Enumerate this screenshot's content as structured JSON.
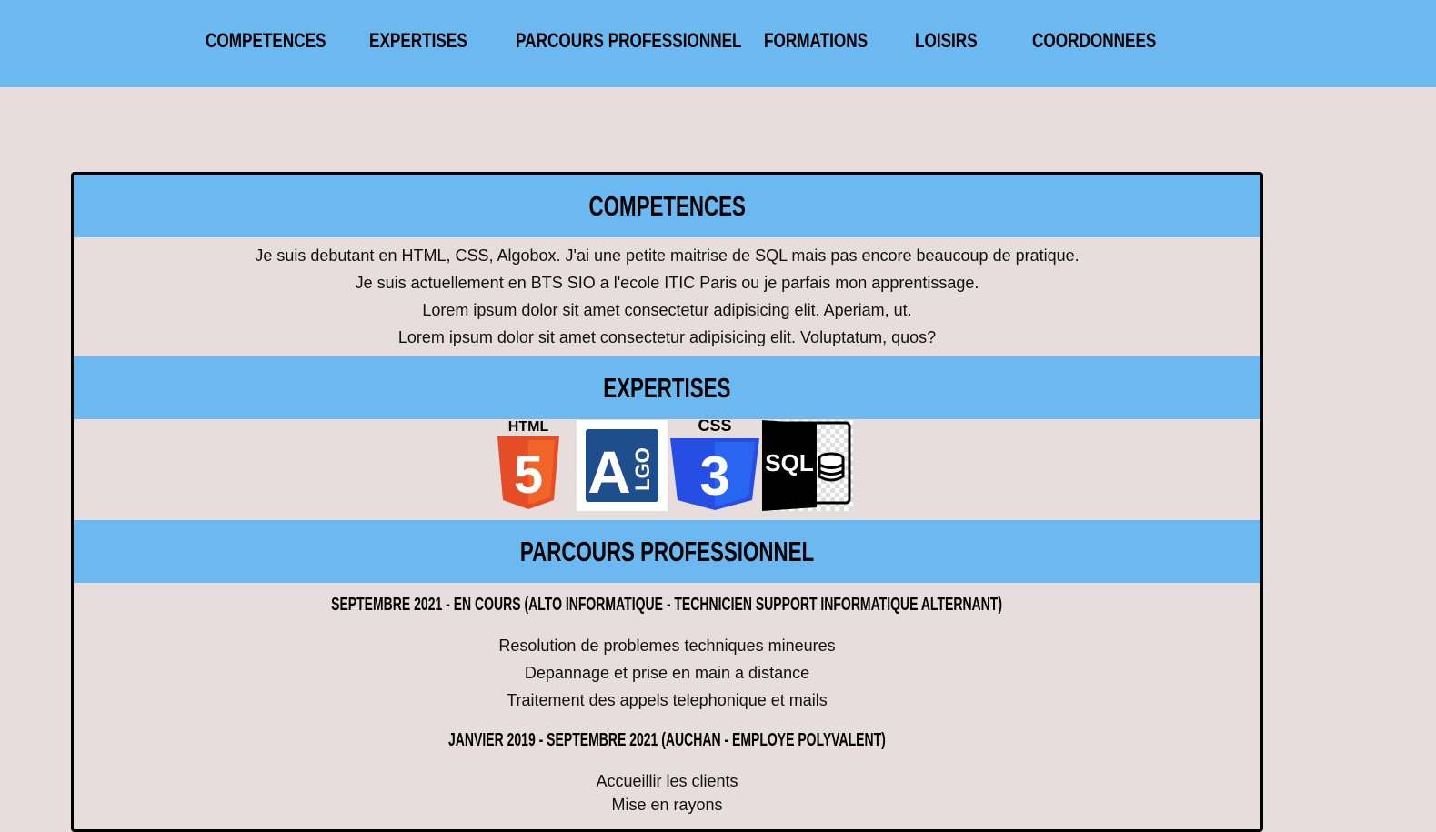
{
  "nav": {
    "items": [
      "COMPETENCES",
      "EXPERTISES",
      "PARCOURS PROFESSIONNEL",
      "FORMATIONS",
      "LOISIRS",
      "COORDONNEES"
    ]
  },
  "competences": {
    "title": "COMPETENCES",
    "lines": [
      "Je suis debutant en HTML, CSS, Algobox. J'ai une petite maitrise de SQL mais pas encore beaucoup de pratique.",
      "Je suis actuellement en BTS SIO a l'ecole ITIC Paris ou je parfais mon apprentissage.",
      "Lorem ipsum dolor sit amet consectetur adipisicing elit. Aperiam, ut.",
      "Lorem ipsum dolor sit amet consectetur adipisicing elit. Voluptatum, quos?"
    ]
  },
  "expertises": {
    "title": "EXPERTISES",
    "logos": {
      "html": "HTML",
      "html_digit": "5",
      "algo": "A",
      "algo_sub": "LGO",
      "css": "CSS",
      "css_digit": "3",
      "sql": "SQL"
    }
  },
  "parcours": {
    "title": "PARCOURS PROFESSIONNEL",
    "jobs": [
      {
        "heading": "SEPTEMBRE 2021 - EN COURS (ALTO INFORMATIQUE - TECHNICIEN SUPPORT INFORMATIQUE ALTERNANT)",
        "tasks": [
          "Resolution de problemes techniques mineures",
          "Depannage et prise en main a distance",
          "Traitement des appels telephonique et mails"
        ]
      },
      {
        "heading": "JANVIER 2019 - SEPTEMBRE 2021 (AUCHAN - EMPLOYE POLYVALENT)",
        "tasks": [
          "Accueillir les clients",
          "Mise en rayons"
        ]
      }
    ]
  },
  "colors": {
    "accent_blue": "#6cb8f1",
    "background": "#e8dddd",
    "html_orange": "#e44d26",
    "css_blue": "#264de4",
    "algo_navy": "#1f4e8c"
  }
}
